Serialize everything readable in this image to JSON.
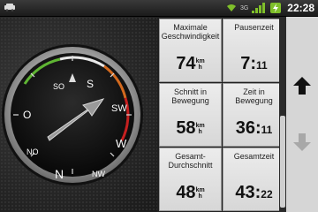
{
  "statusbar": {
    "car_icon": "car-icon",
    "time": "22:28",
    "network": "3G"
  },
  "compass": {
    "labels": {
      "so": "SO",
      "s": "S",
      "sw": "SW",
      "o": "O",
      "w": "W",
      "no": "NO",
      "n": "N",
      "nw": "NW"
    },
    "heading_icon": "heading-arrow-icon"
  },
  "stats": {
    "max_speed": {
      "label_line1": "Maximale",
      "label_line2": "Geschwindigkeit",
      "value": "74",
      "unit_top": "km",
      "unit_bottom": "h"
    },
    "pause_time": {
      "label": "Pausenzeit",
      "value_main": "7:",
      "value_small": "11"
    },
    "avg_moving": {
      "label_line1": "Schnitt in",
      "label_line2": "Bewegung",
      "value": "58",
      "unit_top": "km",
      "unit_bottom": "h"
    },
    "time_moving": {
      "label_line1": "Zeit in",
      "label_line2": "Bewegung",
      "value_main": "36:",
      "value_small": "11"
    },
    "overall_avg": {
      "label_line1": "Gesamt-",
      "label_line2": "Durchschnitt",
      "value": "48",
      "unit_top": "km",
      "unit_bottom": "h"
    },
    "total_time": {
      "label": "Gesamtzeit",
      "value_main": "43:",
      "value_small": "22"
    }
  },
  "nav": {
    "up_icon": "arrow-up-icon",
    "down_icon": "arrow-down-icon"
  }
}
